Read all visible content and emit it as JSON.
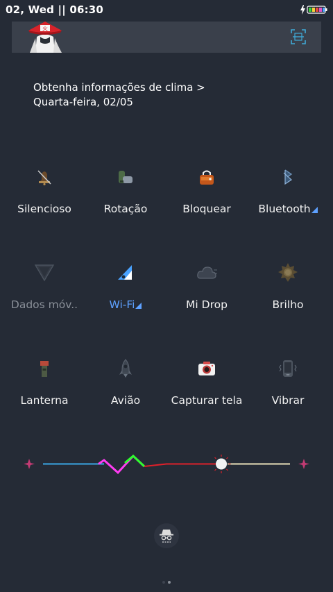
{
  "status": {
    "time": "02, Wed || 06:30"
  },
  "weather": {
    "line1": "Obtenha informações de clima >",
    "line2": "Quarta-feira, 02/05"
  },
  "tiles": [
    {
      "label": "Silencioso",
      "icon": "silent-bell-icon"
    },
    {
      "label": "Rotação",
      "icon": "rotation-lock-icon"
    },
    {
      "label": "Bloquear",
      "icon": "lock-icon"
    },
    {
      "label": "Bluetooth",
      "icon": "bluetooth-icon"
    },
    {
      "label": "Dados móv..",
      "icon": "mobile-data-icon"
    },
    {
      "label": "Wi-Fi",
      "icon": "wifi-icon"
    },
    {
      "label": "Mi Drop",
      "icon": "mi-drop-cloud-icon"
    },
    {
      "label": "Brilho",
      "icon": "brightness-sun-icon"
    },
    {
      "label": "Lanterna",
      "icon": "flashlight-icon"
    },
    {
      "label": "Avião",
      "icon": "airplane-rocket-icon"
    },
    {
      "label": "Capturar tela",
      "icon": "screenshot-camera-icon"
    },
    {
      "label": "Vibrar",
      "icon": "vibrate-phone-icon"
    }
  ],
  "colors": {
    "background": "#252b36",
    "card": "#3a404b",
    "accent": "#5ea1ff",
    "dimText": "#8a9099"
  },
  "brightness": {
    "level": 0.66
  }
}
